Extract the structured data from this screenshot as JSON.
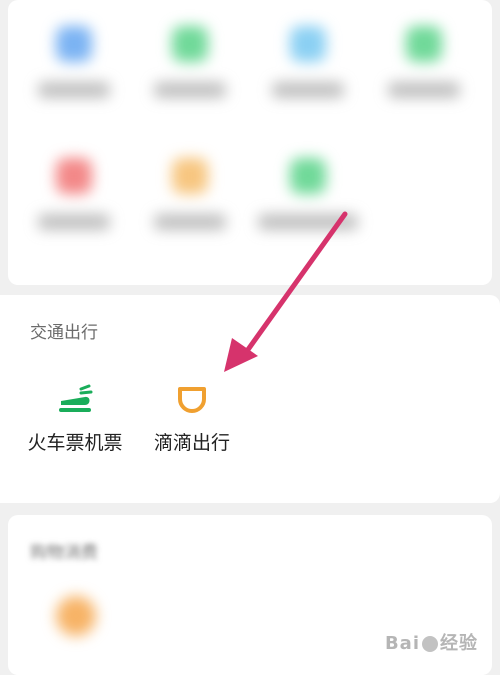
{
  "sections": {
    "transport": {
      "title": "交通出行",
      "items": [
        {
          "label": "火车票机票",
          "icon": "train-ticket-icon",
          "color": "#1aad5a"
        },
        {
          "label": "滴滴出行",
          "icon": "didi-icon",
          "color": "#f0a030"
        }
      ]
    },
    "shopping": {
      "title": "购物消费"
    }
  },
  "colors": {
    "arrow": "#d6336c",
    "blurred_icons": [
      "#5aa0f0",
      "#4cd080",
      "#6ec4f0",
      "#4cd080",
      "#f06a6a",
      "#f5b860",
      "#4cd080",
      "#f5a040"
    ]
  },
  "watermark": {
    "text": "Bai",
    "text2": "经验"
  }
}
